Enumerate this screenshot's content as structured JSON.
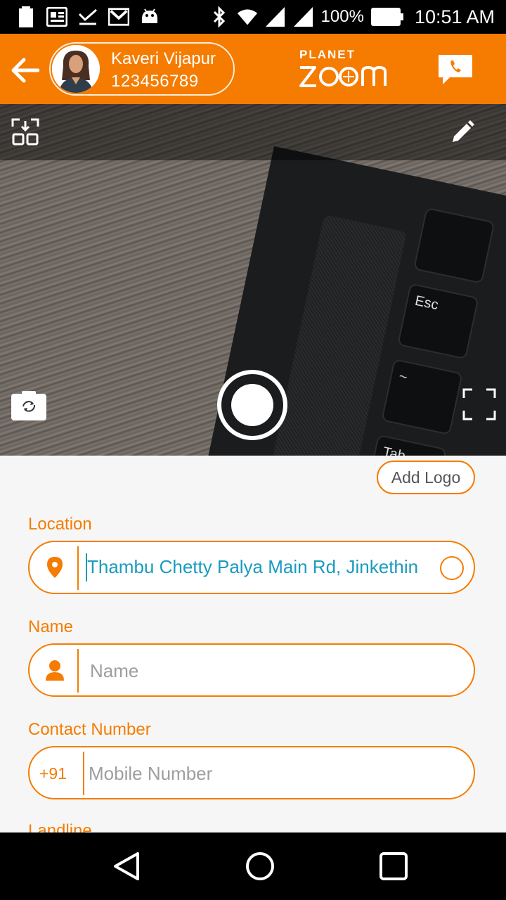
{
  "status_bar": {
    "battery_percent": "100%",
    "time": "10:51 AM",
    "icons_left": [
      "battery-icon",
      "news-icon",
      "check-icon",
      "gmail-icon",
      "android-icon"
    ],
    "icons_right": [
      "bluetooth-icon",
      "wifi-icon",
      "signal-icon",
      "signal-icon",
      "battery-full-icon"
    ]
  },
  "header": {
    "user_name": "Kaveri Vijapur",
    "user_phone": "123456789",
    "brand_top": "PLANET",
    "brand_bottom": "ZOOM",
    "accent_color": "#f57c00"
  },
  "camera": {
    "controls": [
      "qr-scan-icon",
      "edit-icon",
      "flip-camera-icon",
      "shutter-button",
      "fullscreen-icon"
    ]
  },
  "form": {
    "add_logo_label": "Add Logo",
    "location": {
      "label": "Location",
      "value": "Thambu Chetty Palya Main Rd, Jinkethin"
    },
    "name": {
      "label": "Name",
      "placeholder": "Name"
    },
    "contact": {
      "label": "Contact Number",
      "prefix": "+91",
      "placeholder": "Mobile Number"
    },
    "next_label": "Landline"
  },
  "navbar": {
    "buttons": [
      "back-icon",
      "home-icon",
      "recents-icon"
    ]
  }
}
